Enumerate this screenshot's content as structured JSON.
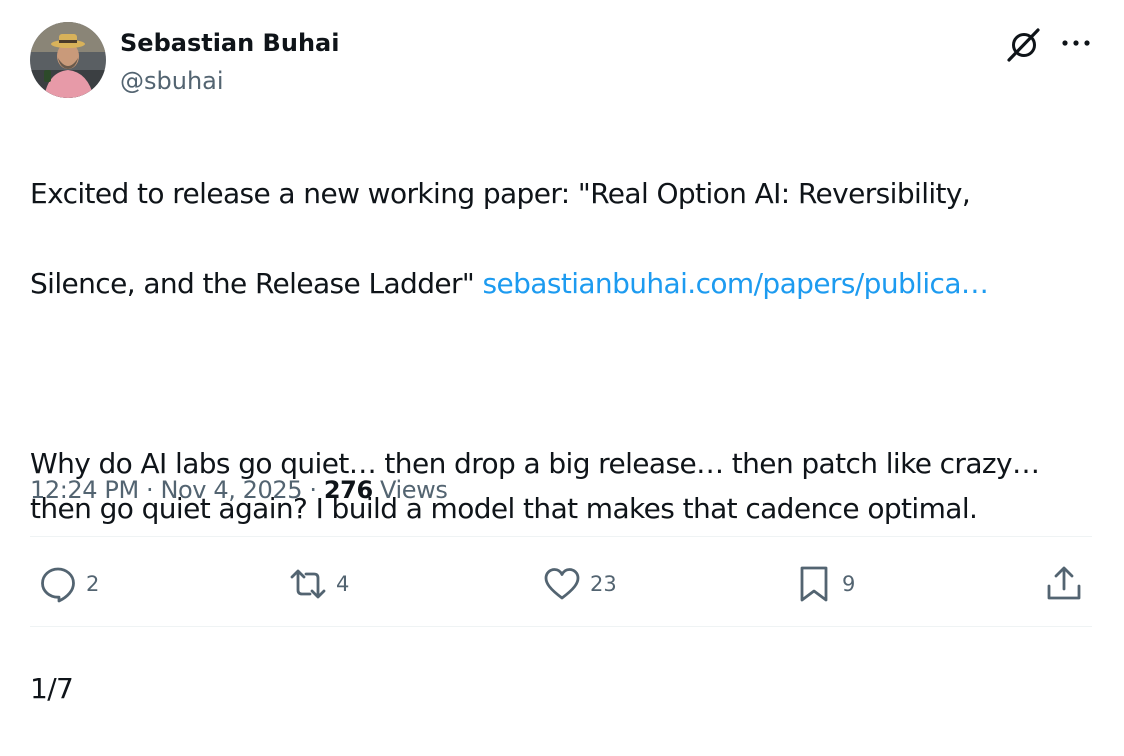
{
  "author": {
    "display_name": "Sebastian Buhai",
    "handle": "@sbuhai"
  },
  "header_icons": [
    "grok-icon",
    "more-icon"
  ],
  "tweet": {
    "line1": "Excited to release a new working paper: \"Real Option AI: Reversibility,",
    "line2_text": "Silence, and the Release Ladder\" ",
    "link_text": "sebastianbuhai.com/papers/publica…",
    "paragraph2": "Why do AI labs go quiet… then drop a big release… then patch like crazy… then go quiet again? I build a model that makes that cadence optimal.",
    "thread_marker": "1/7"
  },
  "meta": {
    "time": "12:24 PM",
    "separator": " · ",
    "date": "Nov 4, 2025",
    "views_count": "276",
    "views_label": " Views"
  },
  "actions": {
    "reply_count": "2",
    "retweet_count": "4",
    "like_count": "23",
    "bookmark_count": "9"
  },
  "colors": {
    "text": "#0f1419",
    "secondary": "#536471",
    "link": "#1d9bf0",
    "divider": "#eff3f4"
  }
}
